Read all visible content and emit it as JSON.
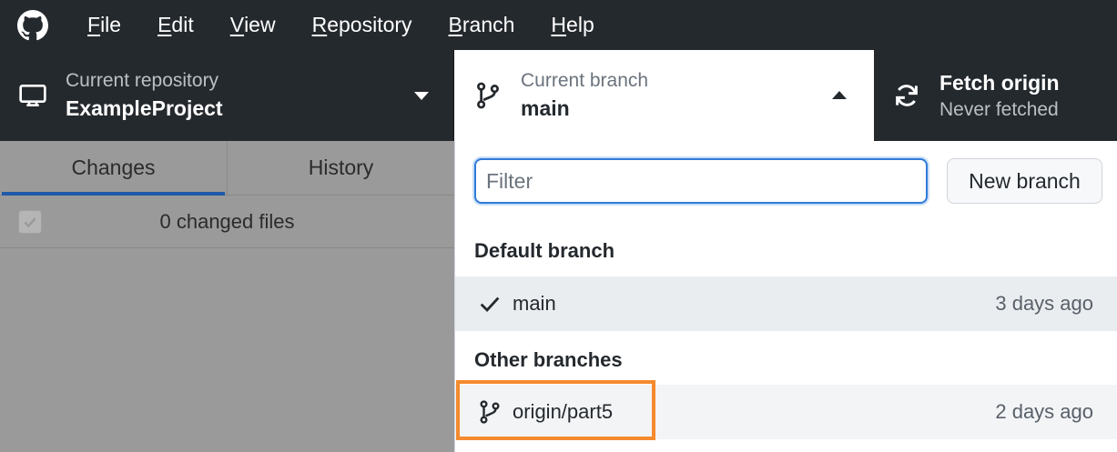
{
  "menubar": {
    "logo_icon": "github-octocat-icon",
    "items": [
      {
        "label": "File",
        "underline": "F",
        "rest": "ile"
      },
      {
        "label": "Edit",
        "underline": "E",
        "rest": "dit"
      },
      {
        "label": "View",
        "underline": "V",
        "rest": "iew"
      },
      {
        "label": "Repository",
        "underline": "R",
        "rest": "epository"
      },
      {
        "label": "Branch",
        "underline": "B",
        "rest": "ranch"
      },
      {
        "label": "Help",
        "underline": "H",
        "rest": "elp"
      }
    ]
  },
  "toolbar": {
    "repository": {
      "label": "Current repository",
      "value": "ExampleProject",
      "icon": "computer-icon"
    },
    "branch": {
      "label": "Current branch",
      "value": "main",
      "icon": "git-branch-icon"
    },
    "fetch": {
      "label": "Fetch origin",
      "sublabel": "Never fetched",
      "icon": "sync-icon"
    }
  },
  "leftpane": {
    "tabs": [
      {
        "label": "Changes",
        "active": true
      },
      {
        "label": "History",
        "active": false
      }
    ],
    "changes_summary": "0 changed files"
  },
  "branch_dropdown": {
    "filter_placeholder": "Filter",
    "new_branch_label": "New branch",
    "default_header": "Default branch",
    "default_branches": [
      {
        "name": "main",
        "time": "3 days ago",
        "icon": "check-icon"
      }
    ],
    "other_header": "Other branches",
    "other_branches": [
      {
        "name": "origin/part5",
        "time": "2 days ago",
        "icon": "git-branch-icon"
      }
    ]
  },
  "colors": {
    "chrome": "#24292e",
    "accent": "#2f7bd9",
    "highlight": "#f58a2e"
  }
}
